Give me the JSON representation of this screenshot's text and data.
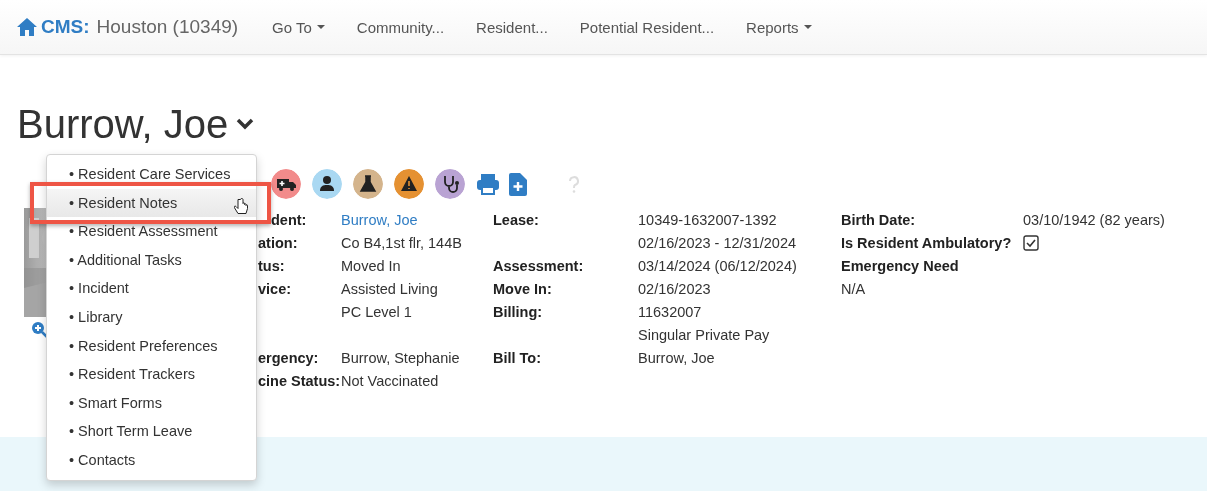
{
  "header": {
    "brand": "CMS:",
    "community": "Houston (10349)",
    "nav": [
      {
        "label": "Go To",
        "dropdown": true
      },
      {
        "label": "Community...",
        "dropdown": false
      },
      {
        "label": "Resident...",
        "dropdown": false
      },
      {
        "label": "Potential Resident...",
        "dropdown": false
      },
      {
        "label": "Reports",
        "dropdown": true
      }
    ]
  },
  "resident": {
    "name": "Burrow, Joe",
    "actions": [
      {
        "kind": "ambulance",
        "color": "#f28b8b"
      },
      {
        "kind": "doctor",
        "color": "#a9d8f2"
      },
      {
        "kind": "flask",
        "color": "#d4b48c"
      },
      {
        "kind": "warning",
        "color": "#e59132"
      },
      {
        "kind": "stethoscope",
        "color": "#b9a3d3"
      },
      {
        "kind": "printer",
        "color": "#2f7dc4"
      },
      {
        "kind": "file-plus",
        "color": "#2f7dc4"
      },
      {
        "kind": "help",
        "color": "#dddddd"
      }
    ],
    "details": [
      {
        "label_1": "dent:",
        "value_1": "Burrow, Joe",
        "value_1_link": true,
        "label_2": "Lease:",
        "value_2": "10349-1632007-1392",
        "label_3": "Birth Date:",
        "value_3": "03/10/1942 (82 years)"
      },
      {
        "label_1": "ation:",
        "value_1": "Co B4,1st flr, 144B",
        "value_1_link": false,
        "value_2": "02/16/2023 - 12/31/2024",
        "label_3": "Is Resident Ambulatory?",
        "checkbox_3": {
          "checked": true
        }
      },
      {
        "label_1": "tus:",
        "value_1": "Moved In",
        "value_1_link": false,
        "label_2": "Assessment:",
        "value_2": "03/14/2024 (06/12/2024)",
        "label_3": "Emergency Need"
      },
      {
        "label_1": "vice:",
        "value_1": "Assisted Living",
        "value_1_link": false,
        "label_2": "Move In:",
        "value_2": "02/16/2023",
        "label_3_value": "N/A"
      },
      {
        "value_1": "PC Level 1",
        "value_1_link": false,
        "label_2": "Billing:",
        "value_2": "11632007"
      },
      {
        "value_2": "Singular Private Pay"
      },
      {
        "label_1": "ergency:",
        "value_1": "Burrow, Stephanie",
        "value_1_link": false,
        "label_2": "Bill To:",
        "value_2": "Burrow, Joe"
      },
      {
        "label_1": "cine Status:",
        "value_1": "Not Vaccinated",
        "value_1_link": false
      }
    ]
  },
  "menu": {
    "items": [
      {
        "label": "• Resident Care Services",
        "selected": false
      },
      {
        "label": "• Resident Notes",
        "selected": true
      },
      {
        "label": "• Resident Assessment",
        "selected": false
      },
      {
        "label": "• Additional Tasks",
        "selected": false
      },
      {
        "label": "• Incident",
        "selected": false
      },
      {
        "label": "• Library",
        "selected": false
      },
      {
        "label": "• Resident Preferences",
        "selected": false
      },
      {
        "label": "• Resident Trackers",
        "selected": false
      },
      {
        "label": "• Smart Forms",
        "selected": false
      },
      {
        "label": "• Short Term Leave",
        "selected": false
      },
      {
        "label": "• Contacts",
        "selected": false
      }
    ]
  }
}
